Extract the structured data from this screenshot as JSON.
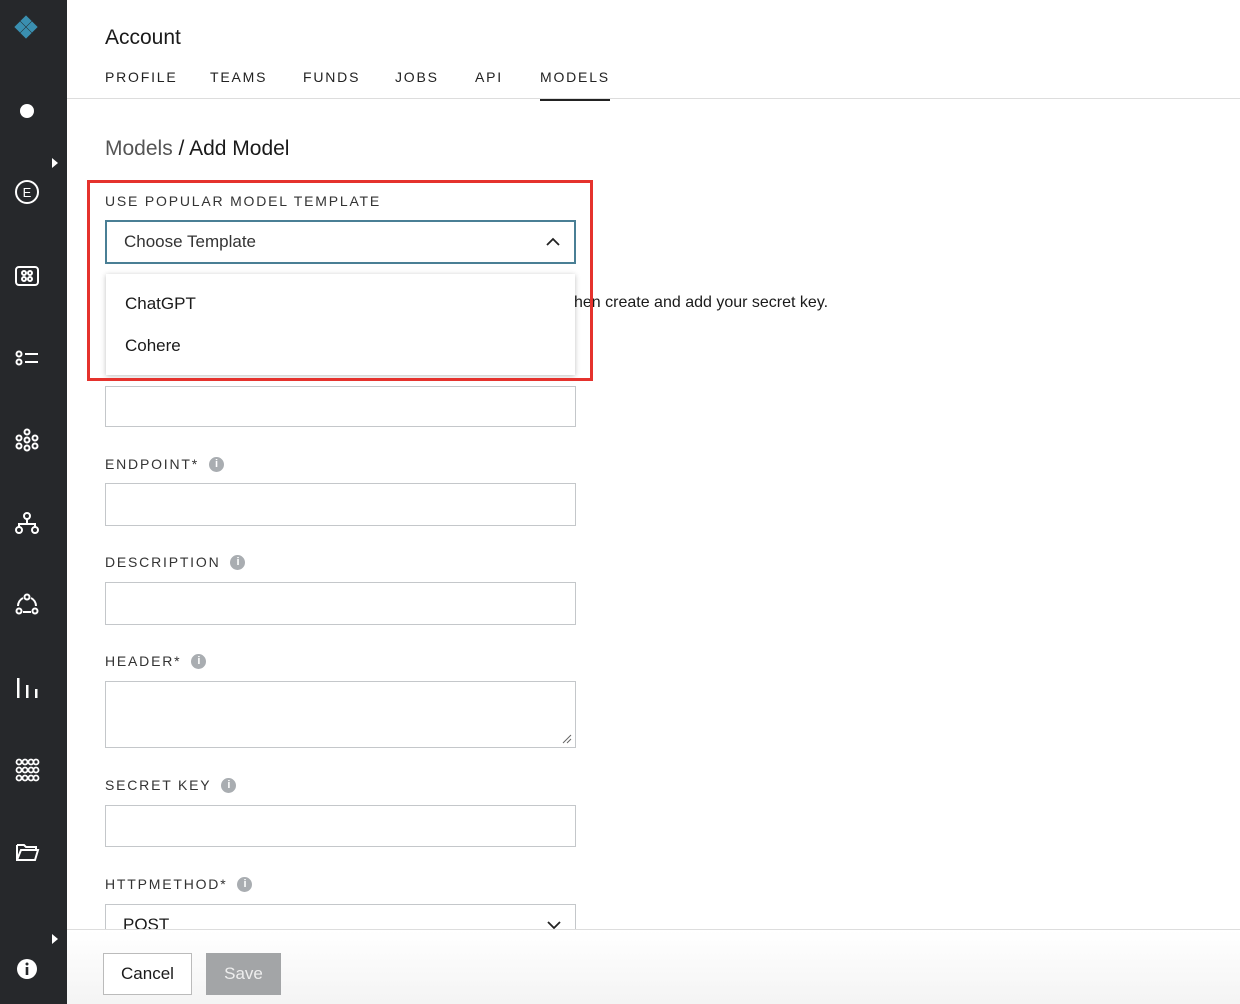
{
  "header": {
    "title": "Account",
    "tabs": [
      {
        "label": "PROFILE"
      },
      {
        "label": "TEAMS"
      },
      {
        "label": "FUNDS"
      },
      {
        "label": "JOBS"
      },
      {
        "label": "API"
      },
      {
        "label": "MODELS"
      }
    ],
    "active_tab": "MODELS"
  },
  "breadcrumb": {
    "parent": "Models",
    "separator": "/",
    "current": "Add Model"
  },
  "template": {
    "label": "USE POPULAR MODEL TEMPLATE",
    "placeholder": "Choose Template",
    "options": [
      "ChatGPT",
      "Cohere"
    ]
  },
  "help_text_partial": "hen create and add your secret key.",
  "fields": {
    "endpoint": "ENDPOINT*",
    "description": "DESCRIPTION",
    "header": "HEADER*",
    "secret_key": "SECRET KEY",
    "http_method": "HTTPMETHOD*",
    "http_method_value": "POST"
  },
  "info_glyph": "i",
  "footer": {
    "cancel": "Cancel",
    "save": "Save"
  },
  "colors": {
    "sidebar": "#26282b",
    "highlight": "#e5322d",
    "focus": "#4a7f95",
    "logo": "#3a8fb0"
  }
}
